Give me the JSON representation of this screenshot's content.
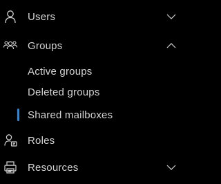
{
  "nav": {
    "users": {
      "label": "Users",
      "icon": "person-icon",
      "expanded": false
    },
    "groups": {
      "label": "Groups",
      "icon": "people-icon",
      "expanded": true,
      "children": [
        {
          "label": "Active groups",
          "selected": false
        },
        {
          "label": "Deleted groups",
          "selected": false
        },
        {
          "label": "Shared mailboxes",
          "selected": true
        }
      ]
    },
    "roles": {
      "label": "Roles",
      "icon": "person-badge-icon"
    },
    "resources": {
      "label": "Resources",
      "icon": "printer-icon",
      "expanded": false
    }
  },
  "colors": {
    "background": "#000000",
    "text": "#d4d4d4",
    "accent": "#2b88d8"
  }
}
